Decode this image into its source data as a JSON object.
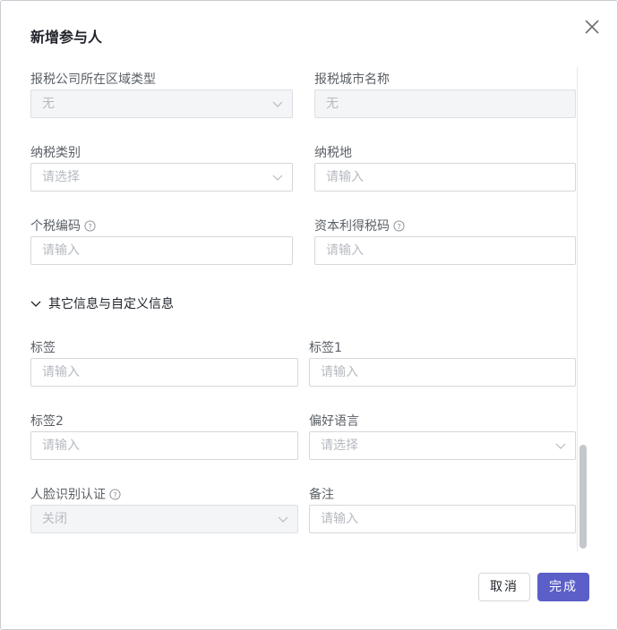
{
  "dialog": {
    "title": "新增参与人",
    "close_icon": "close-icon"
  },
  "fields": {
    "tax_region_type": {
      "label": "报税公司所在区域类型",
      "value": "无"
    },
    "tax_city_name": {
      "label": "报税城市名称",
      "value": "无"
    },
    "tax_category": {
      "label": "纳税类别",
      "placeholder": "请选择"
    },
    "tax_place": {
      "label": "纳税地",
      "placeholder": "请输入"
    },
    "personal_tax_code": {
      "label": "个税编码",
      "placeholder": "请输入"
    },
    "capital_gains_tax_code": {
      "label": "资本利得税码",
      "placeholder": "请输入"
    },
    "tag": {
      "label": "标签",
      "placeholder": "请输入"
    },
    "tag1": {
      "label": "标签1",
      "placeholder": "请输入"
    },
    "tag2": {
      "label": "标签2",
      "placeholder": "请输入"
    },
    "preferred_language": {
      "label": "偏好语言",
      "placeholder": "请选择"
    },
    "face_recognition": {
      "label": "人脸识别认证",
      "value": "关闭"
    },
    "remark": {
      "label": "备注",
      "placeholder": "请输入"
    }
  },
  "section": {
    "other_info": "其它信息与自定义信息"
  },
  "footer": {
    "cancel": "取消",
    "done": "完成"
  },
  "colors": {
    "primary": "#5b5fc7"
  }
}
